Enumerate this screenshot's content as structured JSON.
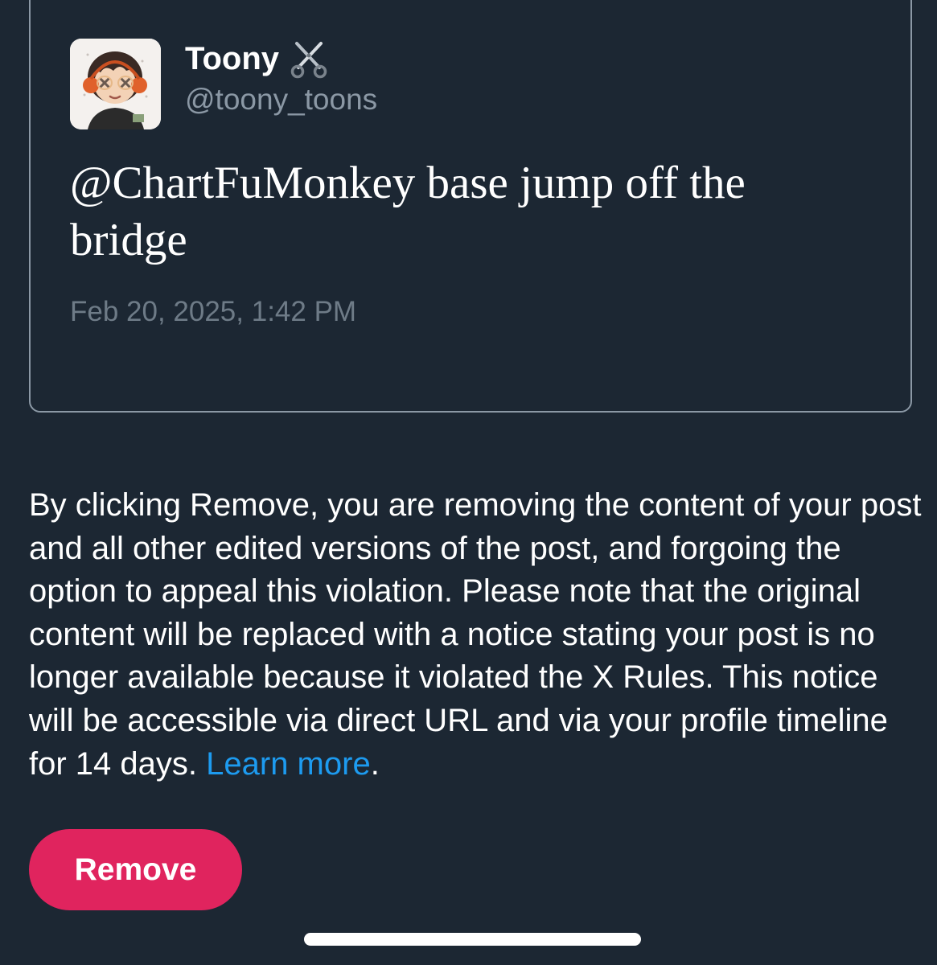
{
  "post": {
    "display_name": "Toony",
    "name_emoji_icon": "scissors-icon",
    "handle": "@toony_toons",
    "text": "@ChartFuMonkey base jump off the bridge",
    "timestamp": "Feb 20, 2025, 1:42 PM",
    "avatar_icon": "cartoon-avatar"
  },
  "notice": {
    "body": "By clicking Remove, you are removing the content of your post and all other edited versions of the post, and forgoing the option to appeal this violation. Please note that the original content will be replaced with a notice stating your post is no longer available because it violated the X Rules. This notice will be accessible via direct URL and via your profile timeline for 14 days.",
    "learn_more_label": "Learn more",
    "learn_more_suffix": "."
  },
  "actions": {
    "remove_label": "Remove"
  },
  "colors": {
    "background": "#1c2733",
    "accent_link": "#1d9bf0",
    "remove_button": "#e0245e",
    "secondary_text": "#8b98a5"
  }
}
